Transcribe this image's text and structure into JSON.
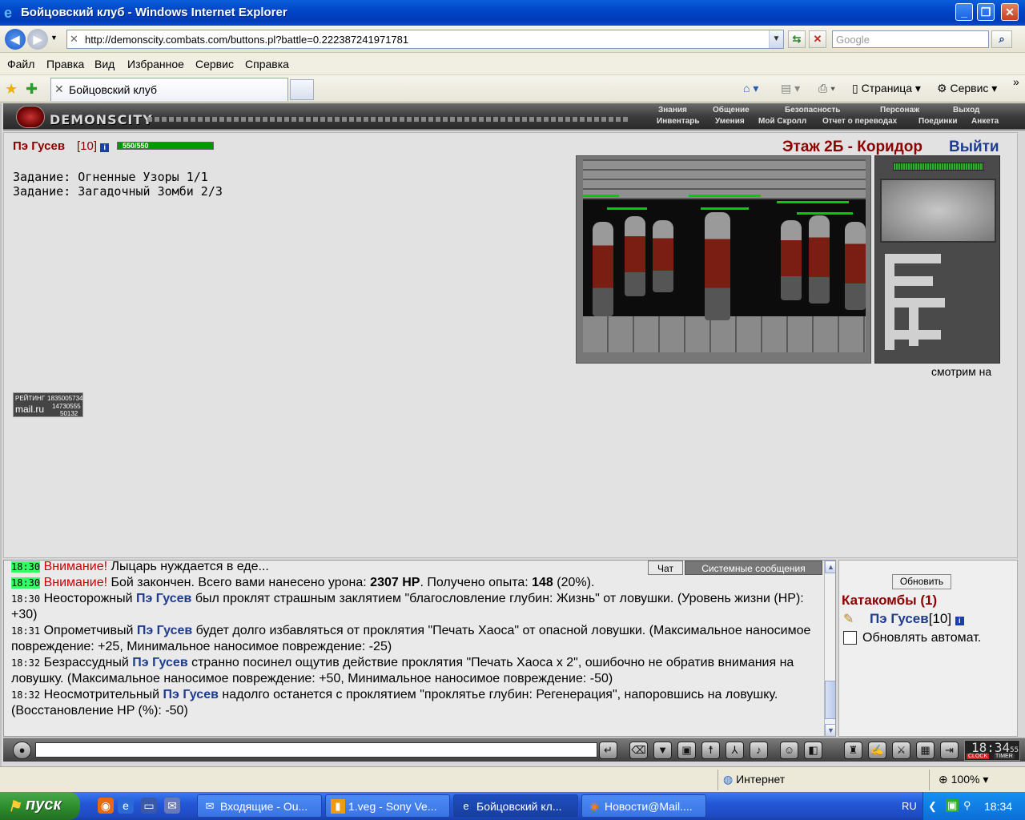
{
  "window": {
    "title": "Бойцовский клуб - Windows Internet Explorer",
    "min": "_",
    "max": "❐",
    "close": "✕"
  },
  "address": {
    "url": "http://demonscity.combats.com/buttons.pl?battle=0.222387241971781",
    "search_placeholder": "Google"
  },
  "menu": [
    "Файл",
    "Правка",
    "Вид",
    "Избранное",
    "Сервис",
    "Справка"
  ],
  "tab": {
    "label": "Бойцовский клуб"
  },
  "commands": {
    "page": "Страница",
    "tools": "Сервис"
  },
  "game": {
    "logo": "DEMONSCITY",
    "topnav": [
      "Знания",
      "Общение",
      "Безопасность",
      "Персонаж",
      "Выход"
    ],
    "subnav": [
      "Инвентарь",
      "Умения",
      "Мой Скролл",
      "Отчет о переводах",
      "Поединки",
      "Анкета"
    ],
    "player": {
      "name": "Пэ Гусев",
      "level": "[10]",
      "hp_text": "550/550",
      "hp_fraction": 1.0
    },
    "quests": [
      "Задание: Огненные Узоры 1/1",
      "Задание: Загадочный Зомби 2/3"
    ],
    "location": "Этаж 2Б - Коридор",
    "exit": "Выйти",
    "watching": "смотрим на",
    "counter": {
      "label": "РЕЙТИНГ",
      "brand": "mail.ru",
      "line1": "1835005734",
      "line2": "14730555",
      "line3": "50132"
    }
  },
  "chat": {
    "tabs": [
      "Чат",
      "Системные сообщения"
    ],
    "lines": [
      {
        "time": "18:30",
        "highlight": true,
        "parts": [
          [
            "warn",
            "Внимание!"
          ],
          [
            "",
            " Лыцарь нуждается в еде..."
          ]
        ]
      },
      {
        "time": "18:30",
        "highlight": true,
        "parts": [
          [
            "warn",
            "Внимание!"
          ],
          [
            "",
            " Бой закончен. Всего вами нанесено урона: "
          ],
          [
            "b",
            "2307 HP"
          ],
          [
            "",
            ". Получено опыта: "
          ],
          [
            "b",
            "148"
          ],
          [
            "",
            " (20%)."
          ]
        ]
      },
      {
        "time": "18:30",
        "highlight": false,
        "parts": [
          [
            "",
            "Неосторожный "
          ],
          [
            "p",
            "Пэ Гусев"
          ],
          [
            "",
            " был проклят страшным заклятием \"благословление глубин: Жизнь\" от ловушки. (Уровень жизни (HP): +30)"
          ]
        ]
      },
      {
        "time": "18:31",
        "highlight": false,
        "parts": [
          [
            "",
            "Опрометчивый "
          ],
          [
            "p",
            "Пэ Гусев"
          ],
          [
            "",
            " будет долго избавляться от проклятия \"Печать Хаоса\" от опасной ловушки. (Максимальное наносимое повреждение: +25, Минимальное наносимое повреждение: -25)"
          ]
        ]
      },
      {
        "time": "18:32",
        "highlight": false,
        "parts": [
          [
            "",
            "Безрассудный "
          ],
          [
            "p",
            "Пэ Гусев"
          ],
          [
            "",
            " странно посинел ощутив действие проклятия \"Печать Хаоса x 2\", ошибочно не обратив внимания на ловушку. (Максимальное наносимое повреждение: +50, Минимальное наносимое повреждение: -50)"
          ]
        ]
      },
      {
        "time": "18:32",
        "highlight": false,
        "parts": [
          [
            "",
            "Неосмотрительный "
          ],
          [
            "p",
            "Пэ Гусев"
          ],
          [
            "",
            " надолго останется с проклятием \"проклятье глубин: Регенерация\", напоровшись на ловушку. (Восстановление HP (%): -50)"
          ]
        ]
      }
    ]
  },
  "side": {
    "refresh": "Обновить",
    "room": "Катакомбы (1)",
    "member": "Пэ Гусев",
    "member_level": "[10]",
    "auto": "Обновлять автомат."
  },
  "clock": {
    "time": "18:34",
    "sec": "55",
    "l1": "CLOCK",
    "l2": "TIMER"
  },
  "status": {
    "zone": "Интернет",
    "zoom": "100%"
  },
  "taskbar": {
    "start": "пуск",
    "tasks": [
      "Входящие - Ou...",
      "1.veg - Sony Ve...",
      "Бойцовский кл...",
      "Новости@Mail...."
    ],
    "lang": "RU",
    "time": "18:34"
  }
}
